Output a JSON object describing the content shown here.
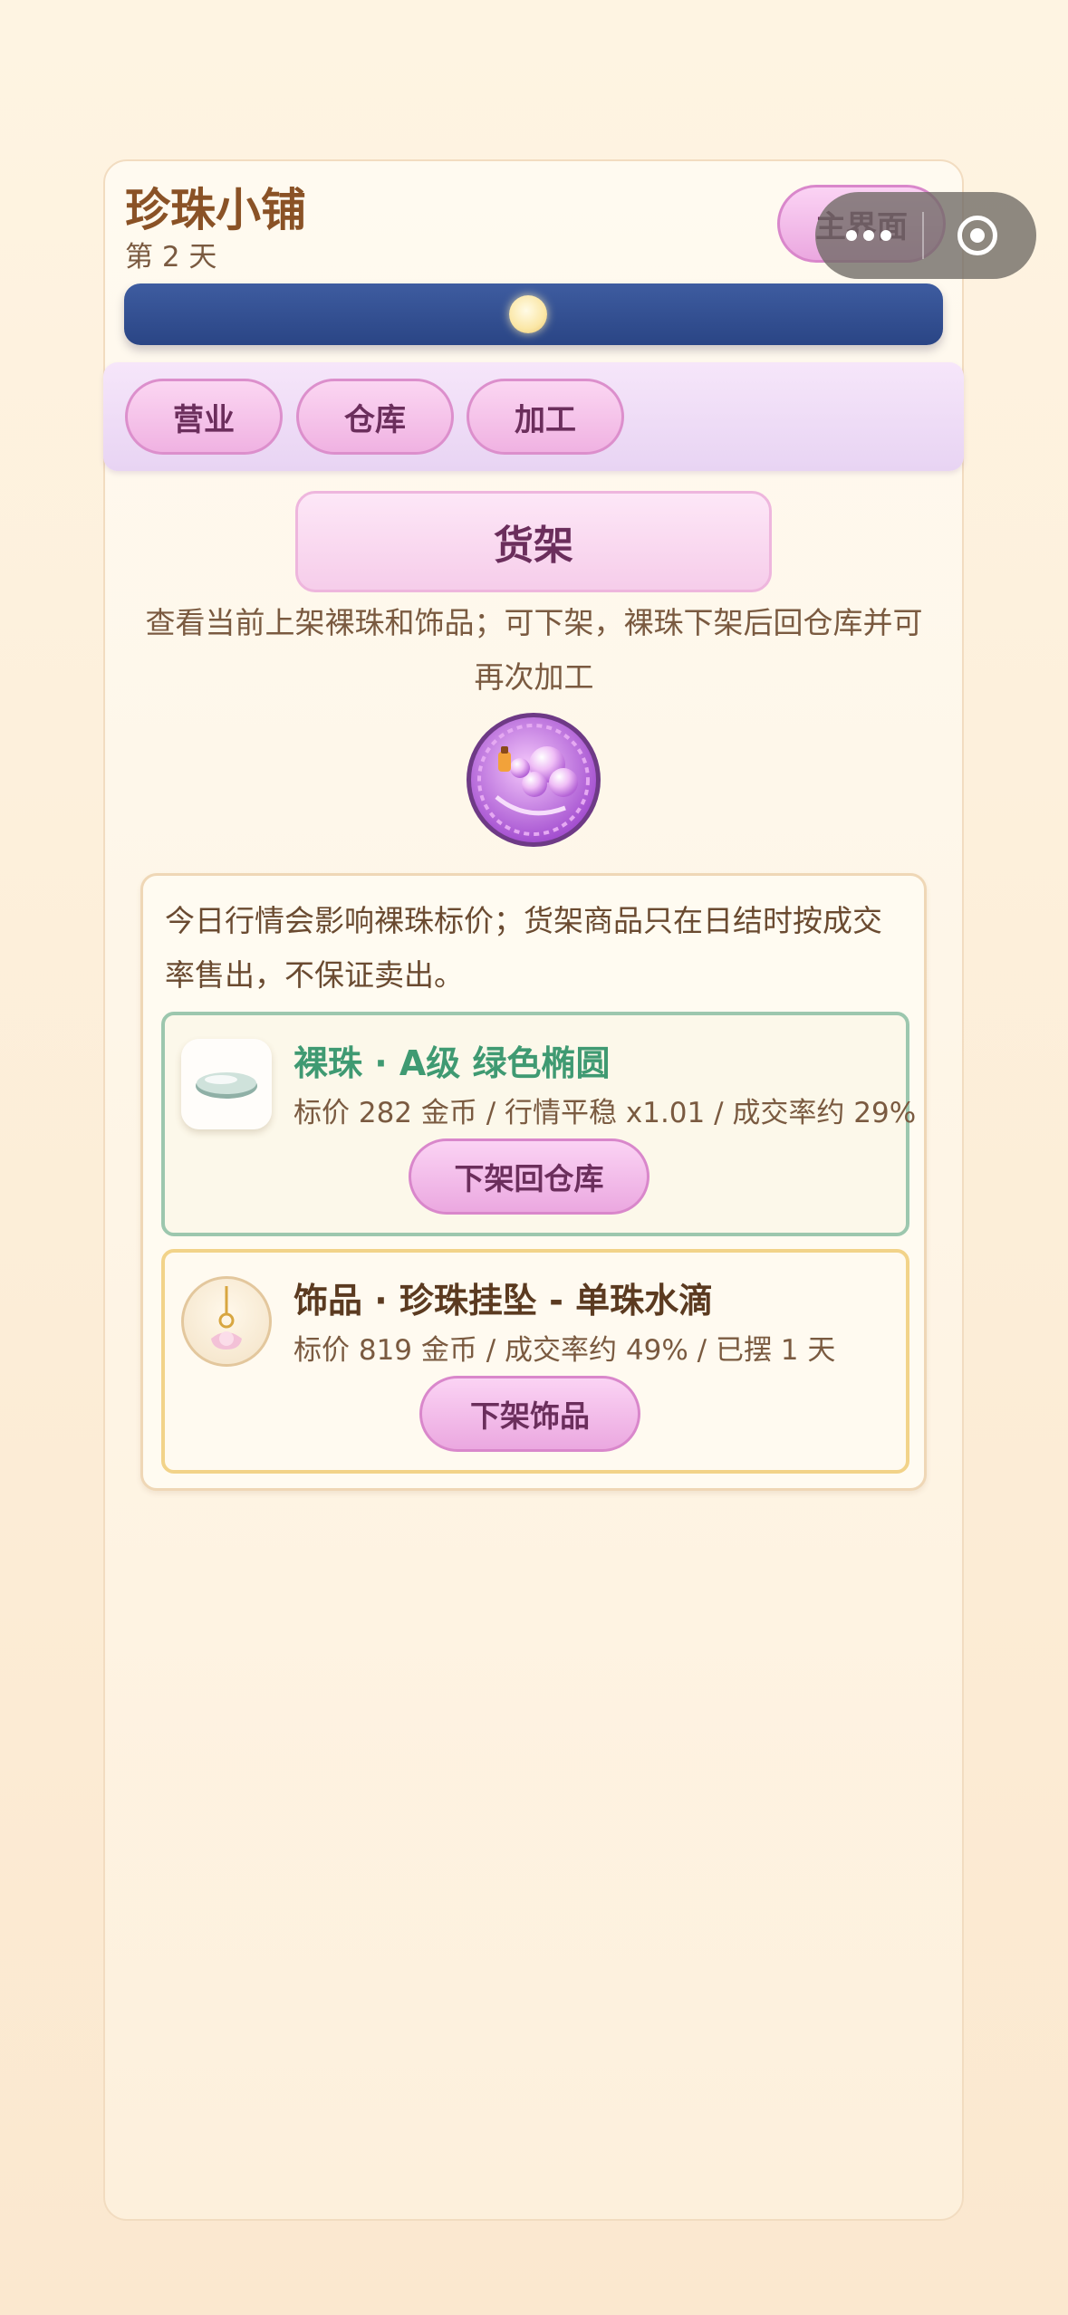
{
  "header": {
    "shop_name": "珍珠小铺",
    "day_label": "第 2 天",
    "home_button": "主界面"
  },
  "tabs": [
    {
      "label": "营业"
    },
    {
      "label": "仓库"
    },
    {
      "label": "加工"
    }
  ],
  "shelf": {
    "button_label": "货架",
    "description": "查看当前上架裸珠和饰品；可下架，裸珠下架后回仓库并可再次加工"
  },
  "info": {
    "text": "今日行情会影响裸珠标价；货架商品只在日结时按成交率售出，不保证卖出。"
  },
  "items": [
    {
      "title": "裸珠 · A级 绿色椭圆",
      "subtitle": "标价 282 金币 / 行情平稳 x1.01 / 成交率约 29%",
      "button": "下架回仓库",
      "icon": "oval-pearl-icon"
    },
    {
      "title": "饰品 · 珍珠挂坠 - 单珠水滴",
      "subtitle": "标价 819 金币 / 成交率约 49% / 已摆 1 天",
      "button": "下架饰品",
      "icon": "pendant-icon"
    }
  ],
  "colors": {
    "accent_pink": "#eba8e0",
    "day_bar": "#2a4585",
    "pearl_item_title": "#3f9a72"
  }
}
